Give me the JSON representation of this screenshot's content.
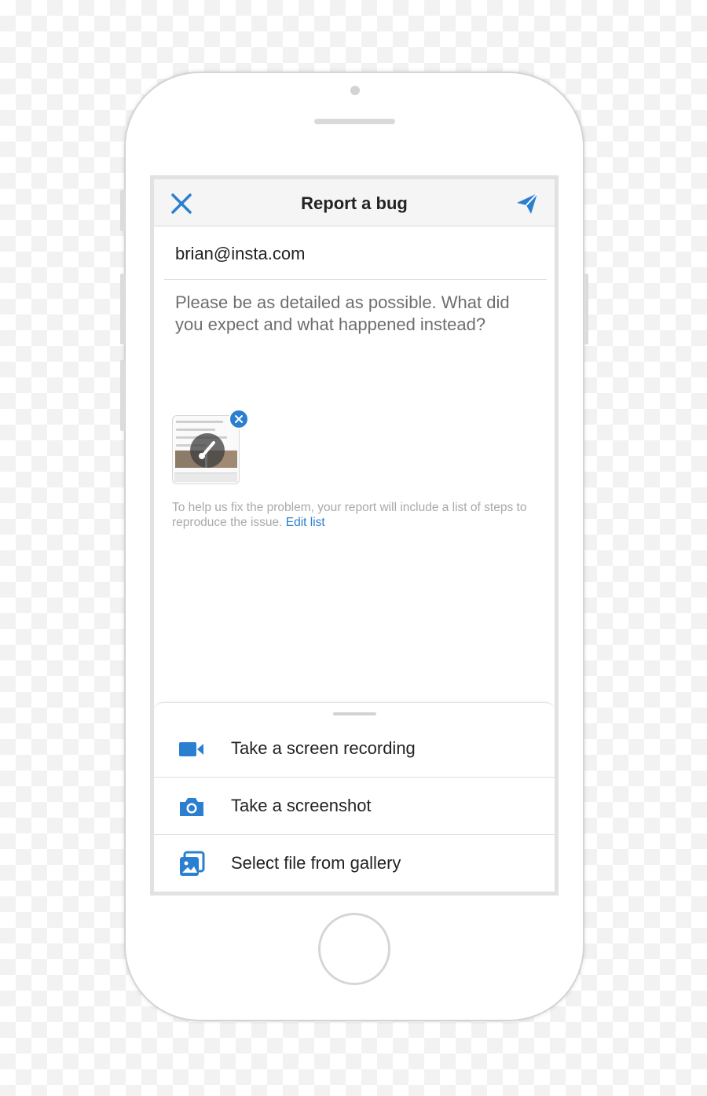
{
  "header": {
    "title": "Report a bug",
    "close_icon": "close-icon",
    "send_icon": "send-icon"
  },
  "form": {
    "email": "brian@insta.com",
    "description_placeholder": "Please be as detailed as possible. What did you expect and what happened instead?"
  },
  "attachment": {
    "thumbnail": "screenshot-thumbnail",
    "remove_icon": "close-icon",
    "edit_icon": "brush-icon"
  },
  "info": {
    "text": "To help us fix the problem, your report will include a list of steps to reproduce the issue.",
    "link_label": "Edit list"
  },
  "sheet": {
    "options": [
      {
        "label": "Take a screen recording",
        "icon": "video-camera-icon"
      },
      {
        "label": "Take a screenshot",
        "icon": "camera-icon"
      },
      {
        "label": "Select file from gallery",
        "icon": "gallery-icon"
      }
    ]
  },
  "colors": {
    "accent": "#2b7fd1",
    "text": "#222222",
    "placeholder": "#6e6e6e",
    "hint": "#a9a9a9"
  }
}
